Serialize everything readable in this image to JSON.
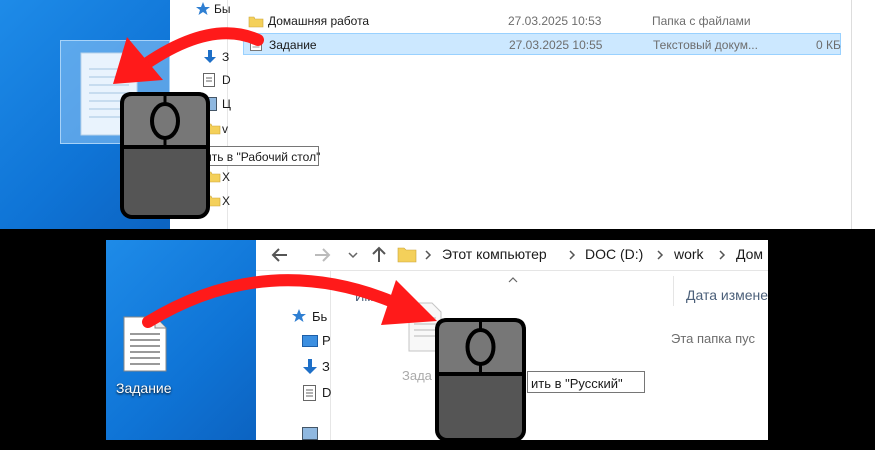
{
  "top_panel": {
    "nav_items": [
      "Бы",
      "З",
      "D",
      "Ц",
      "v",
      "Х",
      "Х"
    ],
    "files": [
      {
        "name": "Домашняя работа",
        "date": "27.03.2025 10:53",
        "type": "Папка с файлами",
        "size": ""
      },
      {
        "name": "Задание",
        "date": "27.03.2025 10:55",
        "type": "Текстовый докум...",
        "size": "0 КБ"
      }
    ],
    "tooltip": "ить в \"Рабочий стол\""
  },
  "bottom_panel": {
    "breadcrumb": [
      "Этот компьютер",
      "DOC (D:)",
      "work",
      "Дом"
    ],
    "desktop_file_label": "Задание",
    "nav_items": [
      "Бь",
      "Р",
      "З",
      "D"
    ],
    "column_name_partial": "Им",
    "column_date_partial": "Дата измене",
    "empty_folder_text": "Эта папка пус",
    "dragged_label_partial": "Зада",
    "tooltip": "ить в \"Русский\""
  },
  "colors": {
    "desktop_blue": "#0f74d6",
    "selection": "#cce8ff",
    "arrow_red": "#ff1a1a",
    "mouse_body": "#555555",
    "mouse_button": "#777777"
  },
  "icons": [
    "folder-icon",
    "text-file-icon",
    "star-icon",
    "download-icon",
    "document-icon",
    "mouse-icon",
    "arrow-left-icon",
    "arrow-right-icon",
    "arrow-up-icon",
    "chevron-right-icon",
    "sort-up-icon"
  ]
}
